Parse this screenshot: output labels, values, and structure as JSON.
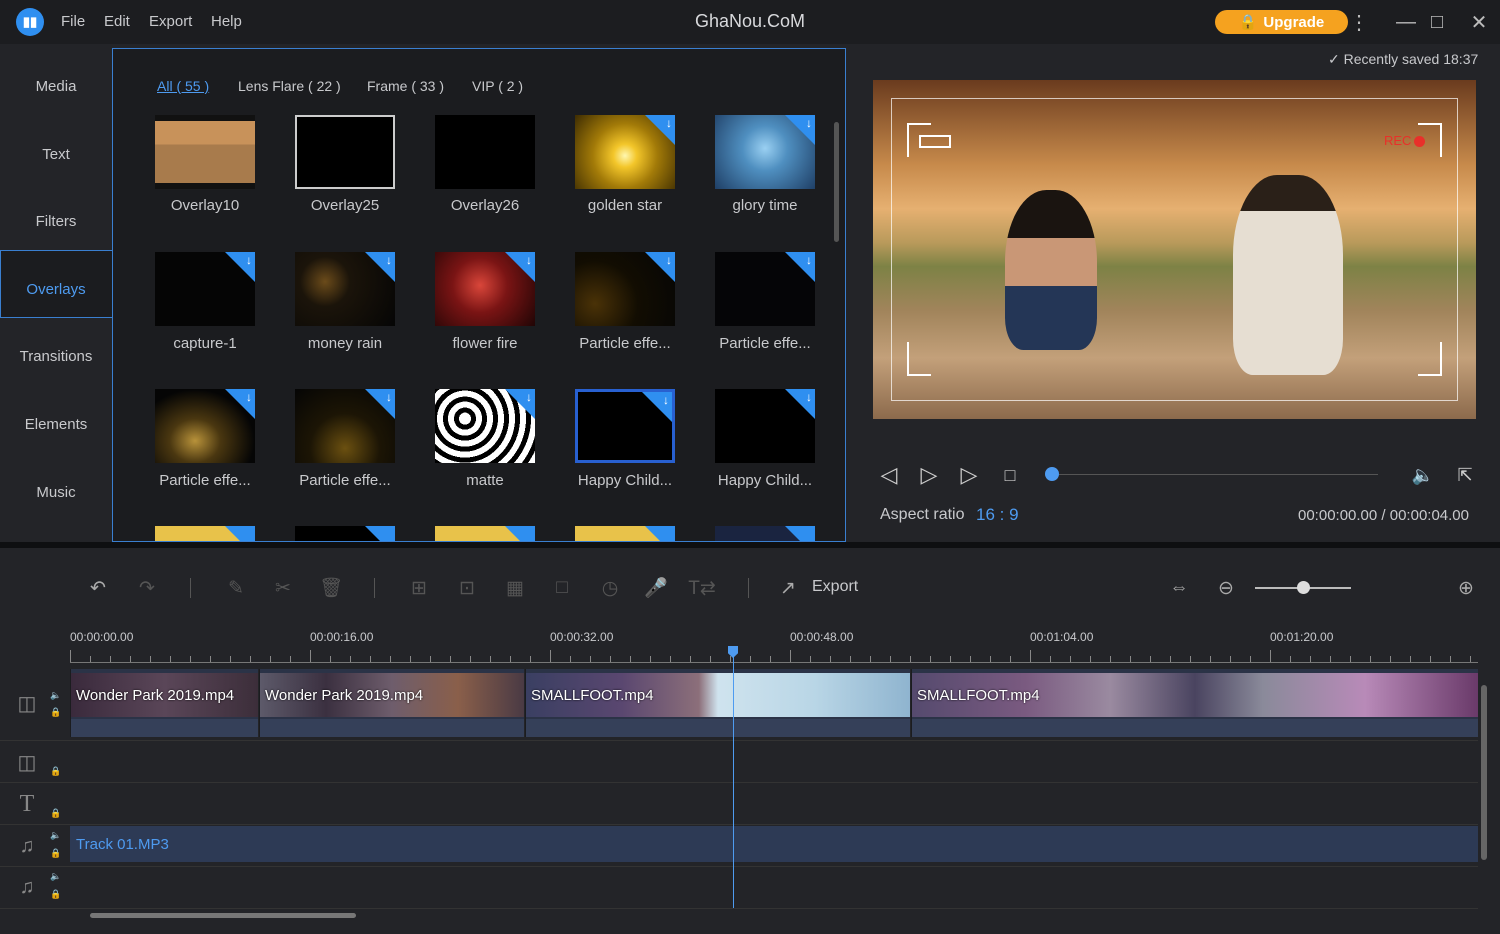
{
  "app": {
    "title": "GhaNou.CoM"
  },
  "menu": [
    "File",
    "Edit",
    "Export",
    "Help"
  ],
  "upgrade_label": "Upgrade",
  "sidebar": {
    "items": [
      "Media",
      "Text",
      "Filters",
      "Overlays",
      "Transitions",
      "Elements",
      "Music"
    ],
    "active": "Overlays"
  },
  "library": {
    "tabs": [
      "All ( 55 )",
      "Lens Flare ( 22 )",
      "Frame ( 33 )",
      "VIP ( 2 )"
    ],
    "tiles": [
      {
        "label": "Overlay10",
        "download": false
      },
      {
        "label": "Overlay25",
        "download": false
      },
      {
        "label": "Overlay26",
        "download": false
      },
      {
        "label": "golden star",
        "download": true
      },
      {
        "label": "glory time",
        "download": true
      },
      {
        "label": "capture-1",
        "download": true
      },
      {
        "label": "money rain",
        "download": true
      },
      {
        "label": "flower fire",
        "download": true
      },
      {
        "label": "Particle effe...",
        "download": true
      },
      {
        "label": "Particle effe...",
        "download": true
      },
      {
        "label": "Particle effe...",
        "download": true
      },
      {
        "label": "Particle effe...",
        "download": true
      },
      {
        "label": "matte",
        "download": true
      },
      {
        "label": "Happy Child...",
        "download": true
      },
      {
        "label": "Happy Child...",
        "download": true
      }
    ]
  },
  "preview": {
    "saved": "Recently saved 18:37",
    "rec": "REC",
    "aspect_label": "Aspect ratio",
    "aspect_value": "16 : 9",
    "timecode": "00:00:00.00 / 00:00:04.00",
    "progress": 0
  },
  "toolbar": {
    "export_label": "Export",
    "zoom_level": 0.43
  },
  "timeline": {
    "ruler": [
      "00:00:00.00",
      "00:00:16.00",
      "00:00:32.00",
      "00:00:48.00",
      "00:01:04.00",
      "00:01:20.00"
    ],
    "clips": [
      "Wonder Park 2019.mp4",
      "Wonder Park 2019.mp4",
      "SMALLFOOT.mp4",
      "SMALLFOOT.mp4"
    ],
    "audio": "Track 01.MP3"
  },
  "colors": {
    "accent": "#4e9bf0",
    "upgrade": "#f5a21f",
    "rec": "#e8302a"
  }
}
